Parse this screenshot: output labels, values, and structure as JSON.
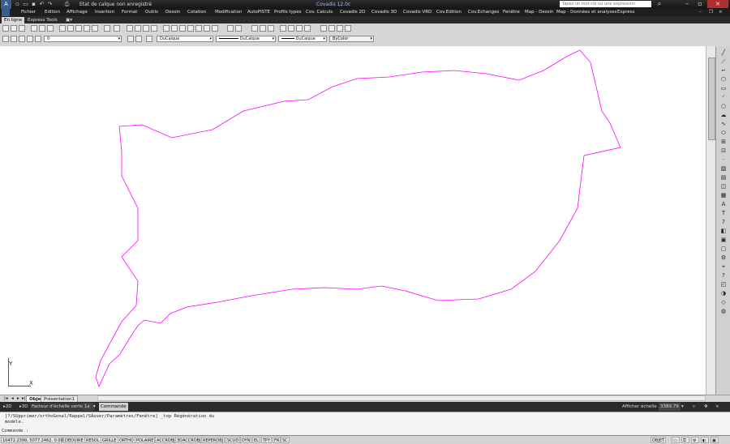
{
  "titlebar": {
    "workspace": "Etat de calque non enregistré",
    "title": "Covadis 12.0c",
    "search_placeholder": "Tapez un mot-clé ou une expression"
  },
  "menubar": {
    "items": [
      "Fichier",
      "Edition",
      "Affichage",
      "Insertion",
      "Format",
      "Outils",
      "Dessin",
      "Cotation",
      "Modification",
      "AutoPISTE",
      "Profils types",
      "Cov. Calculs",
      "Covadis 2D",
      "Covadis 3D",
      "Covadis VRD",
      "Cov.Edition",
      "Cov.Echanges",
      "Fenêtre",
      "Map - Dessin",
      "Map - Données et analyses",
      "Express"
    ]
  },
  "ribbon_tabs": {
    "items": [
      "En ligne",
      "Express Tools"
    ]
  },
  "toolbar": {
    "layer_value": "0",
    "color_value": "DuCalque",
    "linetype_value": "DuCalque",
    "lineweight_value": "DuCalque",
    "plotstyle_value": "ByColor"
  },
  "canvas": {
    "ucs_x": "X",
    "ucs_y": "Y",
    "mesh_color": "#0000ff",
    "boundary_color": "#ff00ff"
  },
  "layout_tabs": {
    "items": [
      "Objet",
      "Présentation1"
    ]
  },
  "status_row": {
    "view_2d": "2D",
    "view_3d": "3D",
    "vscale_label": "Facteur d'échelle verticale :",
    "vscale_value": "1x",
    "command_label": "Commande",
    "annot_label": "Afficher échelle :",
    "annot_value": "3389.79"
  },
  "command_history": {
    "line1": "[?/SUpprimer/orthoGonal/Rappel/SAuver/Paramètres/Fenêtre] _top Régénération du",
    "line2": "modèle.",
    "prompt": "Commande :"
  },
  "statusbar": {
    "coords": "10472.2399, 5077.2462, 0.0000",
    "toggles": [
      "DEDUIRE",
      "RESOL",
      "GRILLE",
      "ORTHO",
      "POLAIRE",
      "ACCROBJ",
      "3DACCROBJ",
      "REPEROBJ",
      "SCUD",
      "DYN",
      "EL",
      "TPY",
      "FR",
      "SC"
    ],
    "space": "OBJET"
  }
}
